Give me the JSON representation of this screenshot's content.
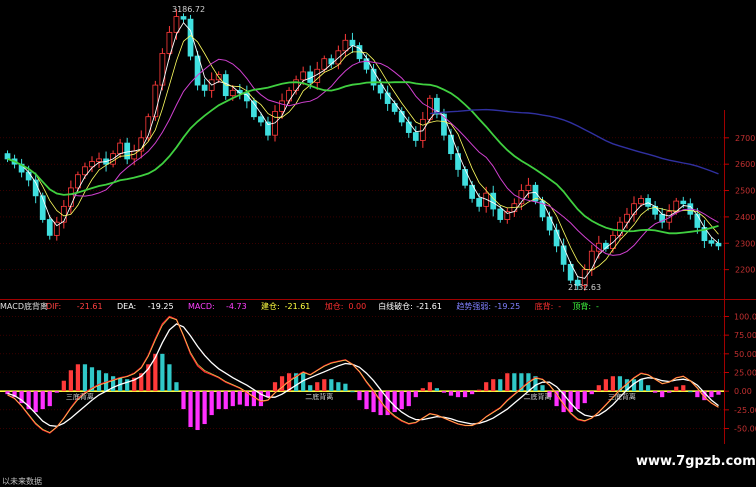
{
  "chart_data": {
    "type": "candlestick",
    "price_panel": {
      "y_axis_ticks": [
        2200,
        2300,
        2400,
        2500,
        2600,
        2700
      ],
      "ylim": [
        2100,
        3200
      ],
      "high_annotation": "3186.72",
      "low_annotation": "2132.63",
      "close": [
        2620,
        2600,
        2570,
        2540,
        2480,
        2390,
        2330,
        2380,
        2440,
        2510,
        2560,
        2590,
        2610,
        2620,
        2600,
        2640,
        2680,
        2620,
        2650,
        2700,
        2780,
        2900,
        3020,
        3100,
        3160,
        3150,
        3010,
        2900,
        2880,
        2920,
        2940,
        2860,
        2880,
        2870,
        2840,
        2780,
        2760,
        2710,
        2800,
        2840,
        2880,
        2920,
        2950,
        2910,
        2960,
        3000,
        2980,
        3030,
        3070,
        3050,
        3000,
        2960,
        2900,
        2870,
        2830,
        2800,
        2760,
        2720,
        2690,
        2770,
        2850,
        2790,
        2710,
        2640,
        2580,
        2520,
        2470,
        2440,
        2490,
        2430,
        2390,
        2420,
        2450,
        2500,
        2520,
        2460,
        2400,
        2350,
        2290,
        2220,
        2160,
        2140,
        2200,
        2270,
        2300,
        2280,
        2330,
        2380,
        2410,
        2450,
        2470,
        2440,
        2410,
        2380,
        2420,
        2460,
        2450,
        2410,
        2360,
        2310,
        2300,
        2290
      ]
    },
    "macd_panel": {
      "title": "MACD底背离",
      "legend": [
        {
          "label": "DIF:",
          "value": "-21.61",
          "color": "#ff4040"
        },
        {
          "label": "DEA:",
          "value": "-19.25",
          "color": "#ffffff"
        },
        {
          "label": "MACD:",
          "value": "-4.73",
          "color": "#ff40ff"
        },
        {
          "label": "建仓:",
          "value": "-21.61",
          "color": "#ffff40"
        },
        {
          "label": "加仓:",
          "value": "0.00",
          "color": "#ff3030"
        },
        {
          "label": "白线破仓:",
          "value": "-21.61",
          "color": "#ffffff"
        },
        {
          "label": "趋势强弱:",
          "value": "-19.25",
          "color": "#8080ff"
        },
        {
          "label": "底背:",
          "value": "-",
          "color": "#ff3030"
        },
        {
          "label": "顶背:",
          "value": "-",
          "color": "#40ff40"
        }
      ],
      "y_axis_ticks": [
        100.0,
        75.0,
        50.0,
        25.0,
        0.0,
        -25.0,
        -50.0
      ],
      "ylim": [
        -60,
        110
      ],
      "dif": [
        -5,
        -10,
        -20,
        -32,
        -44,
        -52,
        -56,
        -48,
        -36,
        -22,
        -10,
        -2,
        4,
        9,
        12,
        15,
        18,
        20,
        24,
        32,
        48,
        70,
        90,
        100,
        96,
        74,
        50,
        34,
        26,
        22,
        18,
        12,
        8,
        4,
        -2,
        -8,
        -14,
        -12,
        -2,
        6,
        14,
        20,
        26,
        22,
        28,
        34,
        38,
        40,
        42,
        36,
        26,
        12,
        0,
        -14,
        -26,
        -34,
        -40,
        -44,
        -42,
        -36,
        -30,
        -32,
        -36,
        -40,
        -44,
        -46,
        -46,
        -42,
        -34,
        -28,
        -22,
        -12,
        -4,
        4,
        12,
        18,
        16,
        8,
        -4,
        -18,
        -30,
        -38,
        -40,
        -36,
        -28,
        -18,
        -8,
        2,
        10,
        18,
        24,
        22,
        16,
        10,
        12,
        18,
        20,
        14,
        4,
        -8,
        -16,
        -21.61
      ],
      "dea": [
        -3,
        -6,
        -12,
        -20,
        -30,
        -40,
        -46,
        -47,
        -43,
        -36,
        -28,
        -20,
        -12,
        -5,
        0,
        5,
        9,
        12,
        15,
        20,
        30,
        45,
        65,
        82,
        90,
        86,
        74,
        60,
        48,
        38,
        30,
        24,
        18,
        13,
        8,
        2,
        -4,
        -8,
        -8,
        -4,
        2,
        8,
        14,
        18,
        22,
        26,
        30,
        34,
        37,
        36,
        32,
        24,
        14,
        2,
        -10,
        -20,
        -28,
        -34,
        -38,
        -38,
        -36,
        -34,
        -35,
        -37,
        -40,
        -42,
        -44,
        -43,
        -40,
        -36,
        -30,
        -24,
        -16,
        -8,
        0,
        8,
        12,
        12,
        6,
        -4,
        -16,
        -26,
        -32,
        -34,
        -32,
        -26,
        -18,
        -8,
        2,
        10,
        16,
        18,
        17,
        14,
        13,
        15,
        16,
        14,
        8,
        -2,
        -12,
        -19.25
      ],
      "signal_labels": [
        {
          "text": "三底背离",
          "index": 10
        },
        {
          "text": "二底背离",
          "index": 44
        },
        {
          "text": "二底背离",
          "index": 75
        },
        {
          "text": "三底背离",
          "index": 87
        }
      ],
      "bottom_text": "以未来数据"
    },
    "watermark": "www.7gpzb.com"
  }
}
